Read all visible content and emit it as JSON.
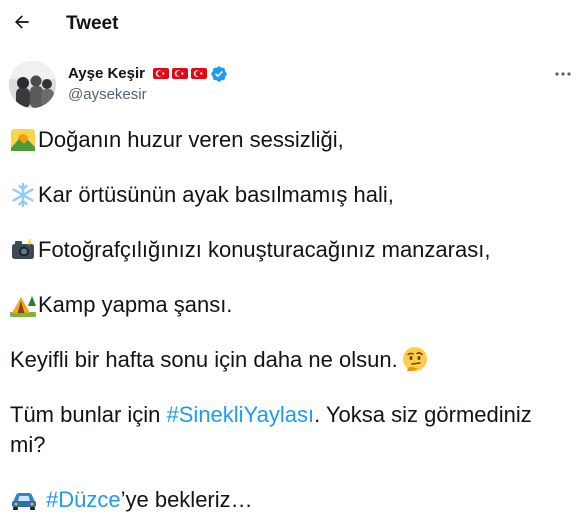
{
  "header": {
    "title": "Tweet"
  },
  "author": {
    "name": "Ayşe Keşir",
    "handle": "@aysekesir"
  },
  "tweet": {
    "line1": "Doğanın huzur veren sessizliği,",
    "line2": "Kar örtüsünün ayak basılmamış hali,",
    "line3": "Fotoğrafçılığınızı konuşturacağınız manzarası,",
    "line4": "Kamp yapma şansı.",
    "line5": "Keyifli bir hafta sonu için daha ne olsun.",
    "line6_prefix": "Tüm bunlar için ",
    "line6_hashtag": "#SinekliYaylası",
    "line6_suffix": ". Yoksa siz görmediniz",
    "line7": "mi?",
    "line8_hashtag": "#Düzce",
    "line8_suffix": "’ye bekleriz…"
  },
  "icons": {
    "back": "arrow-left-icon",
    "verified": "verified-badge-icon",
    "more": "more-icon",
    "flag": "turkey-flag-icon",
    "sunrise": "sunrise-over-mountains-emoji",
    "snowflake": "snowflake-emoji",
    "camera": "camera-with-flash-emoji",
    "camping": "camping-tent-emoji",
    "thinking": "thinking-face-emoji",
    "car": "car-emoji"
  },
  "colors": {
    "accent": "#1d9bf0",
    "secondary_text": "#536471",
    "flag_red": "#e30a17"
  }
}
